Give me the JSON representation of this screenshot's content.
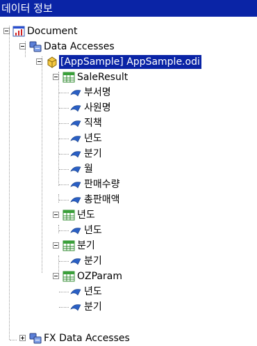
{
  "panel_title": "데이터 정보",
  "tree": {
    "document": {
      "label": "Document",
      "icon": "document-chart-icon"
    },
    "data_accesses": {
      "label": "Data Accesses",
      "icon": "database-group-icon"
    },
    "datasource": {
      "label": "[AppSample] AppSample.odi",
      "icon": "odi-datasource-icon",
      "selected": true
    },
    "saleresult": {
      "label": "SaleResult",
      "fields": [
        "부서명",
        "사원명",
        "직책",
        "년도",
        "분기",
        "월",
        "판매수량",
        "총판매액"
      ]
    },
    "set_year": {
      "label": "년도",
      "fields": [
        "년도"
      ]
    },
    "set_quarter": {
      "label": "분기",
      "fields": [
        "분기"
      ]
    },
    "ozparam": {
      "label": "OZParam",
      "fields": [
        "년도",
        "분기"
      ]
    },
    "fx_data_accesses": {
      "label": "FX Data Accesses",
      "icon": "database-group-icon"
    }
  },
  "colors": {
    "selection": "#0a24a6",
    "tree_line": "#9a9a9a",
    "field_icon": "#2a5fc4"
  }
}
